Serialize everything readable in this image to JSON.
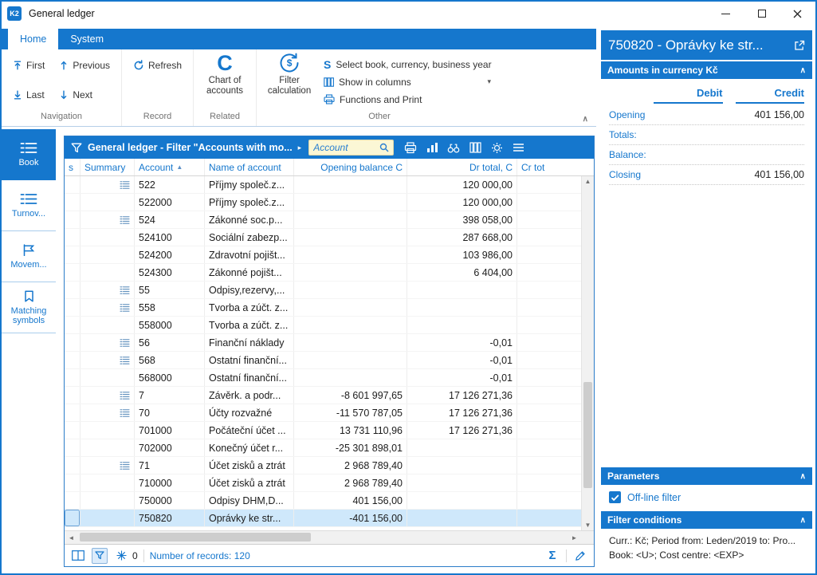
{
  "colors": {
    "accent": "#1577cd",
    "selection": "#cfe8fb",
    "search_bg": "#fbf7d5"
  },
  "icons": {
    "logo": "K2",
    "sort_asc": "▲",
    "caret_right": "▸",
    "caret_down": "▾",
    "scroll_left": "◄",
    "scroll_right": "►",
    "scroll_up": "▲",
    "scroll_down": "▼",
    "sum": "Σ",
    "chevron_up": "∧",
    "chart_c": "C",
    "select_s": "S",
    "currency": "$"
  },
  "titlebar": {
    "title": "General ledger"
  },
  "ribbon": {
    "tabs": [
      {
        "label": "Home",
        "active": true
      },
      {
        "label": "System",
        "active": false
      }
    ],
    "groups": {
      "navigation": {
        "label": "Navigation",
        "items": [
          {
            "label": "First"
          },
          {
            "label": "Previous"
          },
          {
            "label": "Last"
          },
          {
            "label": "Next"
          }
        ]
      },
      "record": {
        "label": "Record",
        "refresh_label": "Refresh"
      },
      "related": {
        "label": "Related",
        "big_button": "Chart of accounts"
      },
      "other": {
        "label": "Other",
        "filter_calculation": "Filter calculation",
        "items": [
          "Select book, currency, business year",
          "Show in columns",
          "Functions and Print"
        ]
      }
    }
  },
  "sidebar": {
    "items": [
      {
        "label": "Book",
        "active": true
      },
      {
        "label": "Turnov...",
        "active": false
      },
      {
        "label": "Movem...",
        "active": false
      },
      {
        "label": "Matching symbols",
        "active": false
      }
    ]
  },
  "grid": {
    "header": {
      "filter_title": "General ledger - Filter \"Accounts with mo...",
      "search_placeholder": "Account"
    },
    "columns": [
      {
        "label": "s"
      },
      {
        "label": "Summary"
      },
      {
        "label": "Account",
        "sorted": "asc"
      },
      {
        "label": "Name of account"
      },
      {
        "label": "Opening balance C"
      },
      {
        "label": "Dr total, C"
      },
      {
        "label": "Cr tot"
      }
    ],
    "rows": [
      {
        "summary": true,
        "account": "522",
        "name": "Příjmy společ.z...",
        "opening": "",
        "dr": "120 000,00"
      },
      {
        "summary": false,
        "account": "522000",
        "name": "Příjmy společ.z...",
        "opening": "",
        "dr": "120 000,00"
      },
      {
        "summary": true,
        "account": "524",
        "name": "Zákonné soc.p...",
        "opening": "",
        "dr": "398 058,00"
      },
      {
        "summary": false,
        "account": "524100",
        "name": "Sociální zabezp...",
        "opening": "",
        "dr": "287 668,00"
      },
      {
        "summary": false,
        "account": "524200",
        "name": "Zdravotní pojišt...",
        "opening": "",
        "dr": "103 986,00"
      },
      {
        "summary": false,
        "account": "524300",
        "name": "Zákonné pojišt...",
        "opening": "",
        "dr": "6 404,00"
      },
      {
        "summary": true,
        "account": "55",
        "name": "Odpisy,rezervy,...",
        "opening": "",
        "dr": ""
      },
      {
        "summary": true,
        "account": "558",
        "name": "Tvorba a zúčt. z...",
        "opening": "",
        "dr": ""
      },
      {
        "summary": false,
        "account": "558000",
        "name": "Tvorba a zúčt. z...",
        "opening": "",
        "dr": ""
      },
      {
        "summary": true,
        "account": "56",
        "name": "Finanční náklady",
        "opening": "",
        "dr": "-0,01"
      },
      {
        "summary": true,
        "account": "568",
        "name": "Ostatní finanční...",
        "opening": "",
        "dr": "-0,01"
      },
      {
        "summary": false,
        "account": "568000",
        "name": "Ostatní finanční...",
        "opening": "",
        "dr": "-0,01"
      },
      {
        "summary": true,
        "account": "7",
        "name": "Závěrk. a podr...",
        "opening": "-8 601 997,65",
        "dr": "17 126 271,36"
      },
      {
        "summary": true,
        "account": "70",
        "name": "Účty rozvažné",
        "opening": "-11 570 787,05",
        "dr": "17 126 271,36"
      },
      {
        "summary": false,
        "account": "701000",
        "name": "Počáteční účet ...",
        "opening": "13 731 110,96",
        "dr": "17 126 271,36"
      },
      {
        "summary": false,
        "account": "702000",
        "name": "Konečný účet r...",
        "opening": "-25 301 898,01",
        "dr": ""
      },
      {
        "summary": true,
        "account": "71",
        "name": "Účet zisků a ztrát",
        "opening": "2 968 789,40",
        "dr": ""
      },
      {
        "summary": false,
        "account": "710000",
        "name": "Účet zisků a ztrát",
        "opening": "2 968 789,40",
        "dr": ""
      },
      {
        "summary": false,
        "account": "750000",
        "name": "Odpisy DHM,D...",
        "opening": "401 156,00",
        "dr": ""
      },
      {
        "summary": false,
        "account": "750820",
        "name": "Oprávky ke str...",
        "opening": "-401 156,00",
        "dr": "",
        "selected": true
      }
    ],
    "status": {
      "counter": "0",
      "records": "Number of records: 120"
    }
  },
  "panel": {
    "title": "750820 - Oprávky ke str...",
    "amounts": {
      "header": "Amounts in currency Kč",
      "col_debit": "Debit",
      "col_credit": "Credit",
      "rows": [
        {
          "label": "Opening",
          "debit": "",
          "credit": "401 156,00"
        },
        {
          "label": "Totals:",
          "debit": "",
          "credit": ""
        },
        {
          "label": "Balance:",
          "debit": "",
          "credit": ""
        },
        {
          "label": "Closing",
          "debit": "",
          "credit": "401 156,00"
        }
      ]
    },
    "parameters": {
      "header": "Parameters",
      "offline_filter": "Off-line filter",
      "checked": true
    },
    "filter_conditions": {
      "header": "Filter conditions",
      "lines": [
        "Curr.: Kč; Period from: Leden/2019 to: Pro...",
        "Book: <U>; Cost centre: <EXP>"
      ]
    }
  }
}
